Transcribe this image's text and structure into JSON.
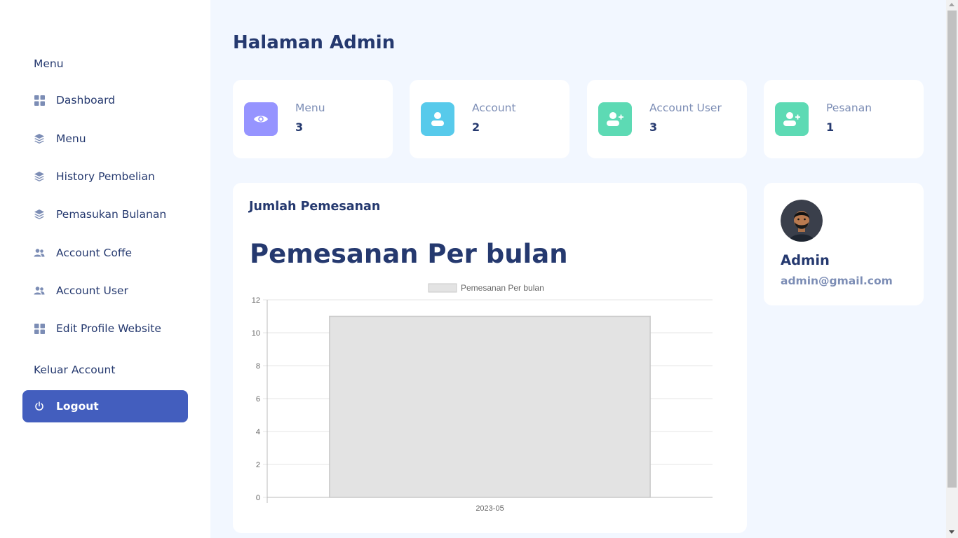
{
  "sidebar": {
    "menu_heading": "Menu",
    "items": [
      {
        "label": "Dashboard",
        "icon": "grid-icon"
      },
      {
        "label": "Menu",
        "icon": "stack-icon"
      },
      {
        "label": "History Pembelian",
        "icon": "stack-icon"
      },
      {
        "label": "Pemasukan Bulanan",
        "icon": "stack-icon"
      },
      {
        "label": "Account Coffe",
        "icon": "people-icon"
      },
      {
        "label": "Account User",
        "icon": "people-icon"
      },
      {
        "label": "Edit Profile Website",
        "icon": "grid-icon"
      }
    ],
    "logout_heading": "Keluar Account",
    "logout_label": "Logout"
  },
  "page": {
    "title": "Halaman Admin"
  },
  "stats": [
    {
      "label": "Menu",
      "value": "3",
      "icon": "eye-icon",
      "color": "#9694ff"
    },
    {
      "label": "Account",
      "value": "2",
      "icon": "user-icon",
      "color": "#57caeb"
    },
    {
      "label": "Account User",
      "value": "3",
      "icon": "user-plus-icon",
      "color": "#5ddab4"
    },
    {
      "label": "Pesanan",
      "value": "1",
      "icon": "user-plus-icon",
      "color": "#5ddab4"
    }
  ],
  "chart_card": {
    "title": "Jumlah Pemesanan",
    "heading": "Pemesanan Per bulan"
  },
  "chart_data": {
    "type": "bar",
    "categories": [
      "2023-05"
    ],
    "series": [
      {
        "name": "Pemesanan Per bulan",
        "values": [
          11
        ]
      }
    ],
    "ylim": [
      0,
      12
    ],
    "yticks": [
      0,
      2,
      4,
      6,
      8,
      10,
      12
    ],
    "legend": "top",
    "grid": true,
    "bar_color": "#e3e3e3",
    "bar_border": "#c8c8c8"
  },
  "profile": {
    "name": "Admin",
    "email": "admin@gmail.com"
  },
  "colors": {
    "accent": "#435ebe",
    "background": "#f2f7ff",
    "text": "#25396f",
    "muted": "#7c8db5"
  }
}
